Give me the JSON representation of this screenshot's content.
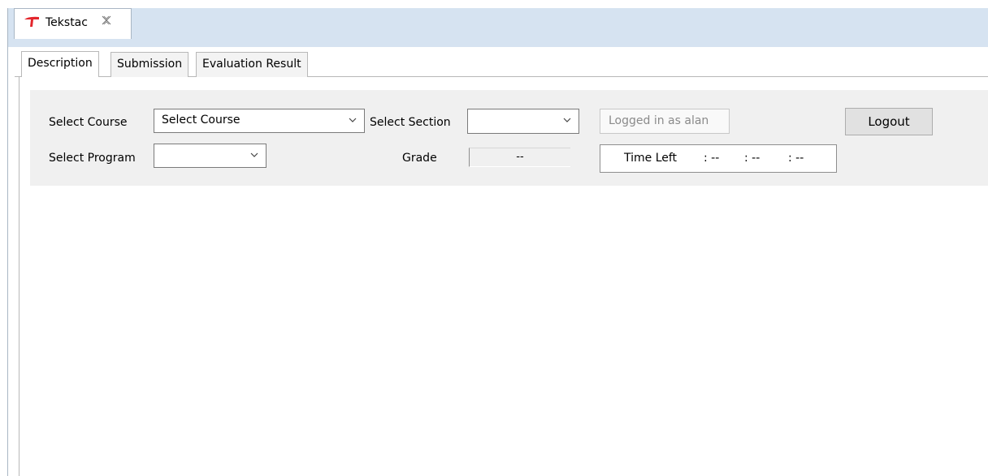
{
  "view": {
    "title": "Tekstac",
    "icon": "tekstac-logo-icon",
    "close_icon": "close-view-icon"
  },
  "tabs": [
    {
      "label": "Description",
      "active": true
    },
    {
      "label": "Submission",
      "active": false
    },
    {
      "label": "Evaluation Result",
      "active": false
    }
  ],
  "form": {
    "select_course_label": "Select Course",
    "course_value": "Select Course",
    "select_section_label": "Select Section",
    "section_value": "",
    "select_program_label": "Select Program",
    "program_value": "",
    "logged_in_text": "Logged in as alan",
    "logout_label": "Logout",
    "grade_label": "Grade",
    "grade_value": "--",
    "time_left_label": "Time Left",
    "time_hours": ": --",
    "time_minutes": ": --",
    "time_seconds": ": --"
  },
  "colors": {
    "accent": "#e3262c",
    "viewbar": "#d6e3f1",
    "panel": "#f0f0f0"
  }
}
